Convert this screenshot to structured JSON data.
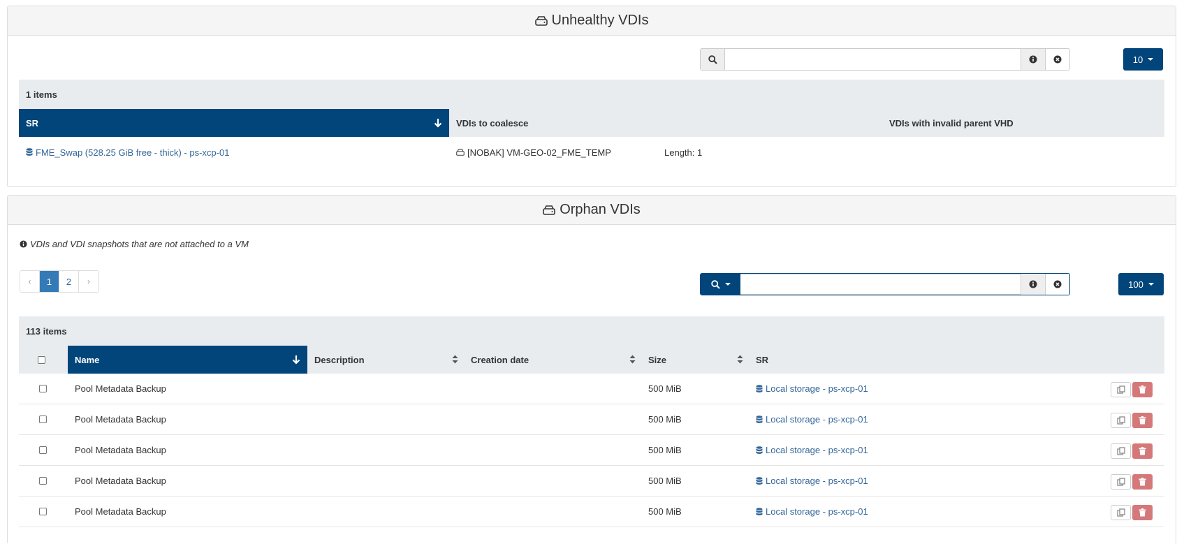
{
  "unhealthy": {
    "title": "Unhealthy VDIs",
    "page_size": "10",
    "count": "1 items",
    "columns": [
      "SR",
      "VDIs to coalesce",
      "VDIs with invalid parent VHD"
    ],
    "row": {
      "sr": "FME_Swap (528.25 GiB free - thick) - ps-xcp-01",
      "vdi": "[NOBAK] VM-GEO-02_FME_TEMP",
      "length": "Length: 1"
    }
  },
  "orphan": {
    "title": "Orphan VDIs",
    "info": "VDIs and VDI snapshots that are not attached to a VM",
    "pagination": {
      "prev": "‹",
      "pages": [
        "1",
        "2"
      ],
      "next": "›"
    },
    "page_size": "100",
    "count": "113 items",
    "columns": [
      "Name",
      "Description",
      "Creation date",
      "Size",
      "SR"
    ],
    "rows": [
      {
        "name": "Pool Metadata Backup",
        "size": "500 MiB",
        "sr": "Local storage - ps-xcp-01"
      },
      {
        "name": "Pool Metadata Backup",
        "size": "500 MiB",
        "sr": "Local storage - ps-xcp-01"
      },
      {
        "name": "Pool Metadata Backup",
        "size": "500 MiB",
        "sr": "Local storage - ps-xcp-01"
      },
      {
        "name": "Pool Metadata Backup",
        "size": "500 MiB",
        "sr": "Local storage - ps-xcp-01"
      },
      {
        "name": "Pool Metadata Backup",
        "size": "500 MiB",
        "sr": "Local storage - ps-xcp-01"
      }
    ]
  },
  "colors": {
    "primary": "#02457a",
    "link": "#336699",
    "danger": "#d5787a",
    "table_header": "#e9ecef"
  },
  "icons": {
    "hdd": "hdd-icon",
    "search": "search-icon",
    "info": "info-icon",
    "clear": "times-circle-icon",
    "database": "database-icon",
    "sort_down": "arrow-down-icon",
    "sort": "sort-icon",
    "copy": "copy-icon",
    "trash": "trash-icon"
  }
}
